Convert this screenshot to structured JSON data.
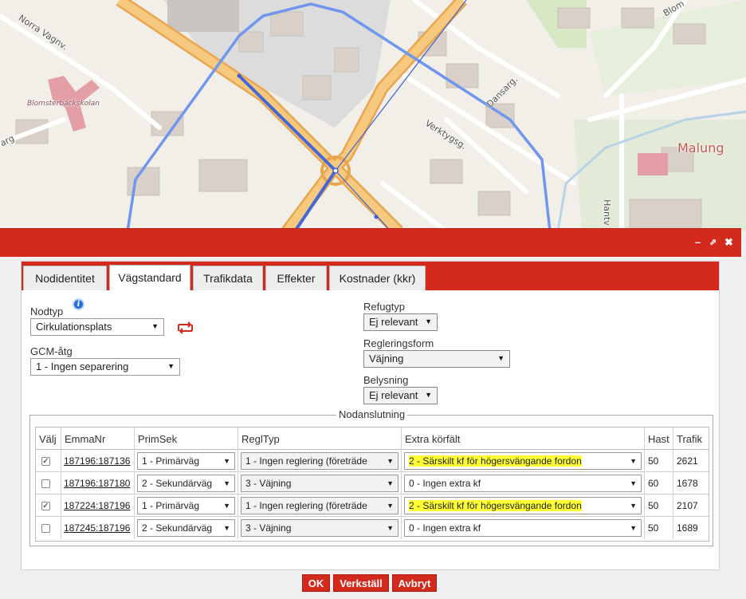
{
  "map": {
    "labels": {
      "norra_vagn": "Norra Vagnv.",
      "blomsterbackskolan": "Blomsterbäckskolan",
      "arg": "arg",
      "dansarg": "Dansarg.",
      "verktygsg": "Verktygsg.",
      "malung": "Malung",
      "hantv": "Hantv",
      "blom": "Blom"
    }
  },
  "window": {
    "minimize_glyph": "–",
    "popout_glyph": "⇗",
    "close_glyph": "✖"
  },
  "tabs": [
    {
      "label": "Nodidentitet"
    },
    {
      "label": "Vägstandard"
    },
    {
      "label": "Trafikdata"
    },
    {
      "label": "Effekter"
    },
    {
      "label": "Kostnader (kkr)"
    }
  ],
  "form": {
    "nodtyp_label": "Nodtyp",
    "info_icon": "i",
    "nodtyp_value": "Cirkulationsplats",
    "gcm_label": "GCM-åtg",
    "gcm_value": "1 - Ingen separering",
    "refugtyp_label": "Refugtyp",
    "refugtyp_value": "Ej relevant",
    "regleringsform_label": "Regleringsform",
    "regleringsform_value": "Väjning",
    "belysning_label": "Belysning",
    "belysning_value": "Ej relevant",
    "caret": "▼"
  },
  "nodanslutning": {
    "legend": "Nodanslutning",
    "headers": {
      "valj": "Välj",
      "emmanr": "EmmaNr",
      "primsek": "PrimSek",
      "regltyp": "ReglTyp",
      "extra": "Extra körfält",
      "hast": "Hast",
      "trafik": "Trafik"
    },
    "rows": [
      {
        "checked": "✓",
        "emmanr": "187196:187136",
        "primsek": "1 - Primärväg",
        "regltyp": "1 - Ingen reglering (företräde",
        "extra": "2 - Särskilt kf för högersvängande fordon",
        "hast": "50",
        "trafik": "2621"
      },
      {
        "checked": "",
        "emmanr": "187196:187180",
        "primsek": "2 - Sekundärväg",
        "regltyp": "3 - Väjning",
        "extra": "0 - Ingen extra kf",
        "hast": "60",
        "trafik": "1678"
      },
      {
        "checked": "✓",
        "emmanr": "187224:187196",
        "primsek": "1 - Primärväg",
        "regltyp": "1 - Ingen reglering (företräde",
        "extra": "2 - Särskilt kf för högersvängande fordon",
        "hast": "50",
        "trafik": "2107"
      },
      {
        "checked": "",
        "emmanr": "187245:187196",
        "primsek": "2 - Sekundärväg",
        "regltyp": "3 - Väjning",
        "extra": "0 - Ingen extra kf",
        "hast": "50",
        "trafik": "1689"
      }
    ]
  },
  "buttons": {
    "ok": "OK",
    "apply": "Verkställ",
    "cancel": "Avbryt"
  },
  "colors": {
    "brand_red": "#d42a1e",
    "highlight": "#ffff33",
    "route_blue": "#7096ee"
  }
}
